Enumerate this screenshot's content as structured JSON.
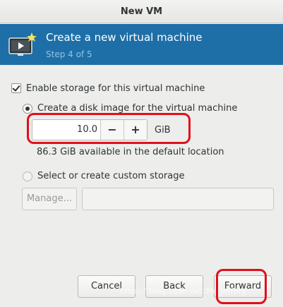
{
  "window": {
    "title": "New VM"
  },
  "banner": {
    "title": "Create a new virtual machine",
    "step": "Step 4 of 5",
    "icon": "vm-monitor-star-icon"
  },
  "storage": {
    "enable_label": "Enable storage for this virtual machine",
    "enable_checked": true,
    "create_disk_label": "Create a disk image for the virtual machine",
    "create_disk_selected": true,
    "disk_size_value": "10.0",
    "decrement_label": "−",
    "increment_label": "+",
    "unit": "GiB",
    "available_text": "86.3 GiB available in the default location",
    "custom_label": "Select or create custom storage",
    "custom_selected": false,
    "manage_label": "Manage...",
    "custom_path_value": ""
  },
  "footer": {
    "cancel_label": "Cancel",
    "back_label": "Back",
    "forward_label": "Forward"
  },
  "watermark": "https://blog.csdn.net/Mr_Jeffery",
  "colors": {
    "banner_bg": "#1e6fa7",
    "highlight": "#e0101b"
  }
}
